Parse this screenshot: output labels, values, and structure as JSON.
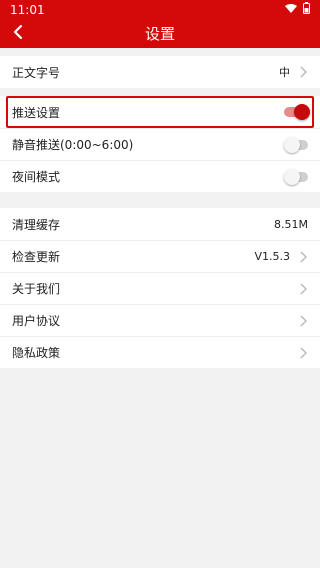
{
  "statusbar": {
    "time": "11:01"
  },
  "header": {
    "title": "设置"
  },
  "settings": {
    "font_size": {
      "label": "正文字号",
      "value": "中"
    },
    "push": {
      "label": "推送设置",
      "enabled": true
    },
    "quiet_push": {
      "label": "静音推送(0:00~6:00)",
      "enabled": false
    },
    "night_mode": {
      "label": "夜间模式",
      "enabled": false
    },
    "clear_cache": {
      "label": "清理缓存",
      "value": "8.51M"
    },
    "check_update": {
      "label": "检查更新",
      "value": "V1.5.3"
    },
    "about": {
      "label": "关于我们"
    },
    "user_agreement": {
      "label": "用户协议"
    },
    "privacy_policy": {
      "label": "隐私政策"
    }
  },
  "colors": {
    "brand_red": "#d40a0a",
    "background": "#f2f2f2"
  }
}
